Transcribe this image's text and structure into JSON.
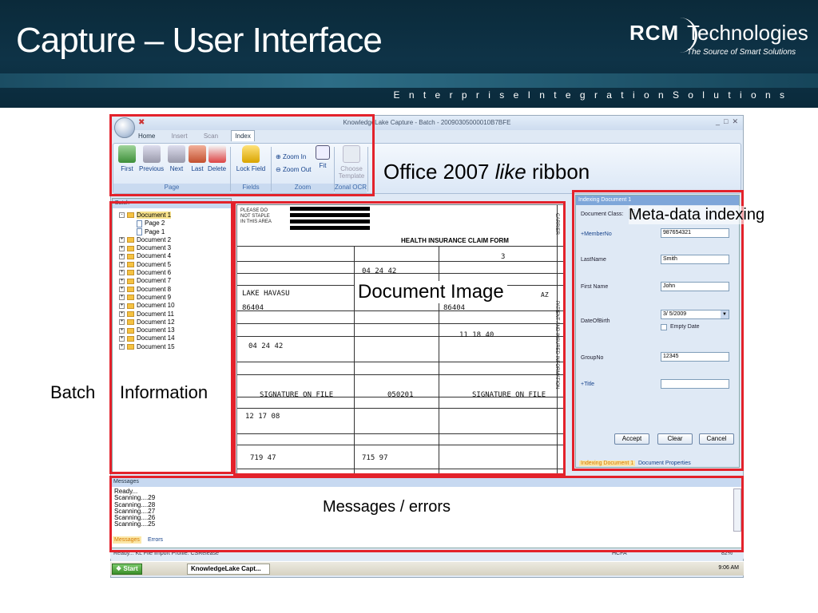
{
  "slide": {
    "title": "Capture  – User Interface",
    "subtitle": "E n t e r p r i s e   I n t e g r a t i o n   S o l u t i o n s",
    "logo_rcm": "RCM",
    "logo_text": "Technologies",
    "logo_tagline": "The Source of Smart Solutions"
  },
  "window": {
    "title": "KnowledgeLake Capture - Batch - 20090305000010B7BFE",
    "tabs": [
      "Home",
      "Insert",
      "Scan",
      "Index"
    ],
    "active_tab": "Index"
  },
  "ribbon": {
    "page_buttons": [
      "First",
      "Previous",
      "Next",
      "Last",
      "Delete"
    ],
    "page_group": "Page",
    "fields_button": "Lock Field",
    "fields_group": "Fields",
    "zoom_in": "Zoom In",
    "zoom_out": "Zoom Out",
    "fit": "Fit",
    "zoom_group": "Zoom",
    "choose_template": "Choose Template",
    "zonal_group": "Zonal OCR"
  },
  "batch": {
    "header": "Batch",
    "documents": [
      {
        "label": "Document 1",
        "expanded": true,
        "children": [
          "Page 2",
          "Page 1"
        ]
      },
      {
        "label": "Document 2"
      },
      {
        "label": "Document 3"
      },
      {
        "label": "Document 4"
      },
      {
        "label": "Document 5"
      },
      {
        "label": "Document 6"
      },
      {
        "label": "Document 7"
      },
      {
        "label": "Document 8"
      },
      {
        "label": "Document 9"
      },
      {
        "label": "Document 10"
      },
      {
        "label": "Document 11"
      },
      {
        "label": "Document 12"
      },
      {
        "label": "Document 13"
      },
      {
        "label": "Document 14"
      },
      {
        "label": "Document 15"
      }
    ]
  },
  "form": {
    "staple": "PLEASE DO NOT STAPLE IN THIS AREA",
    "title": "HEALTH INSURANCE CLAIM FORM",
    "city": "LAKE HAVASU",
    "state": "AZ",
    "zip": "86404",
    "zip2": "86404",
    "dob": "04 24 42",
    "dob2": "11 18 40",
    "signature": "SIGNATURE ON FILE",
    "code": "050201",
    "date": "12 17 08",
    "dx1": "719 47",
    "dx2": "715 97",
    "id": "3",
    "side": "PATIENT AND INSURED INFORMATION",
    "carrier": "CARRIER"
  },
  "indexing": {
    "header": "Indexing Document 1",
    "doc_class_label": "Document Class:",
    "member_no_label": "+MemberNo",
    "member_no": "987654321",
    "lastname_label": "LastName",
    "lastname": "Smith",
    "firstname_label": "First Name",
    "firstname": "John",
    "dob_label": "DateOfBirth",
    "dob": "3/  5/2009",
    "empty_date": "Empty Date",
    "groupno_label": "GroupNo",
    "groupno": "12345",
    "title_label": "+Title",
    "accept": "Accept",
    "clear": "Clear",
    "cancel": "Cancel",
    "tab1": "Indexing Document 1",
    "tab2": "Document Properties"
  },
  "messages": {
    "header": "Messages",
    "lines": [
      "Ready...",
      "Scanning....29",
      "Scanning....28",
      "Scanning....27",
      "Scanning....26",
      "Scanning....25"
    ],
    "tab_messages": "Messages",
    "tab_errors": "Errors"
  },
  "status": {
    "left": "Ready...   KL File Import   Profile: CSRelease",
    "right": "HCFA",
    "zoom": "82%"
  },
  "taskbar": {
    "start": "Start",
    "task": "KnowledgeLake Capt...",
    "time": "9:06 AM"
  },
  "annotations": {
    "ribbon_pre": "Office 2007 ",
    "ribbon_em": "like",
    "ribbon_post": " ribbon",
    "metadata": "Meta-data indexing",
    "document_image": "Document Image",
    "batch": "Batch",
    "information": "Information",
    "messages": "Messages / errors"
  },
  "colors": {
    "highlight": "#e3222b",
    "header_bg": "#0e3347"
  }
}
